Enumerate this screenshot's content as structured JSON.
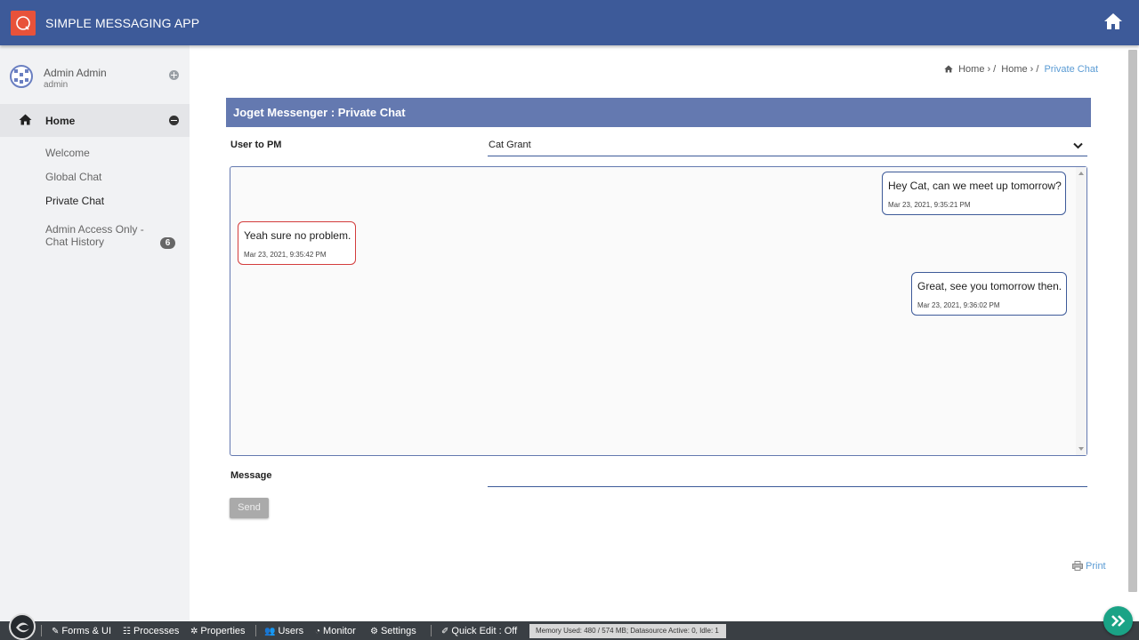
{
  "header": {
    "app_title": "SIMPLE MESSAGING APP"
  },
  "sidebar": {
    "user_name": "Admin Admin",
    "user_login": "admin",
    "home_label": "Home",
    "items": [
      {
        "label": "Welcome"
      },
      {
        "label": "Global Chat"
      },
      {
        "label": "Private Chat"
      },
      {
        "label": "Admin Access Only - Chat History",
        "badge": "6"
      }
    ]
  },
  "breadcrumb": {
    "items": [
      "Home",
      "Home",
      "Private Chat"
    ]
  },
  "panel": {
    "title": "Joget Messenger : Private Chat"
  },
  "form": {
    "user_label": "User to PM",
    "user_value": "Cat Grant",
    "message_label": "Message",
    "send_label": "Send"
  },
  "messages": [
    {
      "side": "sent",
      "text": "Hey Cat, can we meet up tomorrow?",
      "time": "Mar 23, 2021, 9:35:21 PM"
    },
    {
      "side": "recv",
      "text": "Yeah sure no problem.",
      "time": "Mar 23, 2021, 9:35:42 PM"
    },
    {
      "side": "sent",
      "text": "Great, see you tomorrow then.",
      "time": "Mar 23, 2021, 9:36:02 PM"
    }
  ],
  "print_label": "Print",
  "bottombar": {
    "items": [
      "Forms & UI",
      "Processes",
      "Properties",
      "Users",
      "Monitor",
      "Settings",
      "Quick Edit : Off"
    ],
    "memory": "Memory Used: 480 / 574 MB; Datasource Active: 0, Idle: 1"
  },
  "colors": {
    "header": "#3d5a99",
    "panel_header": "#6479b0",
    "sent_border": "#3d5a99",
    "recv_border": "#d33c3c",
    "accent_link": "#5a9bd4",
    "fab": "#1aa386"
  }
}
